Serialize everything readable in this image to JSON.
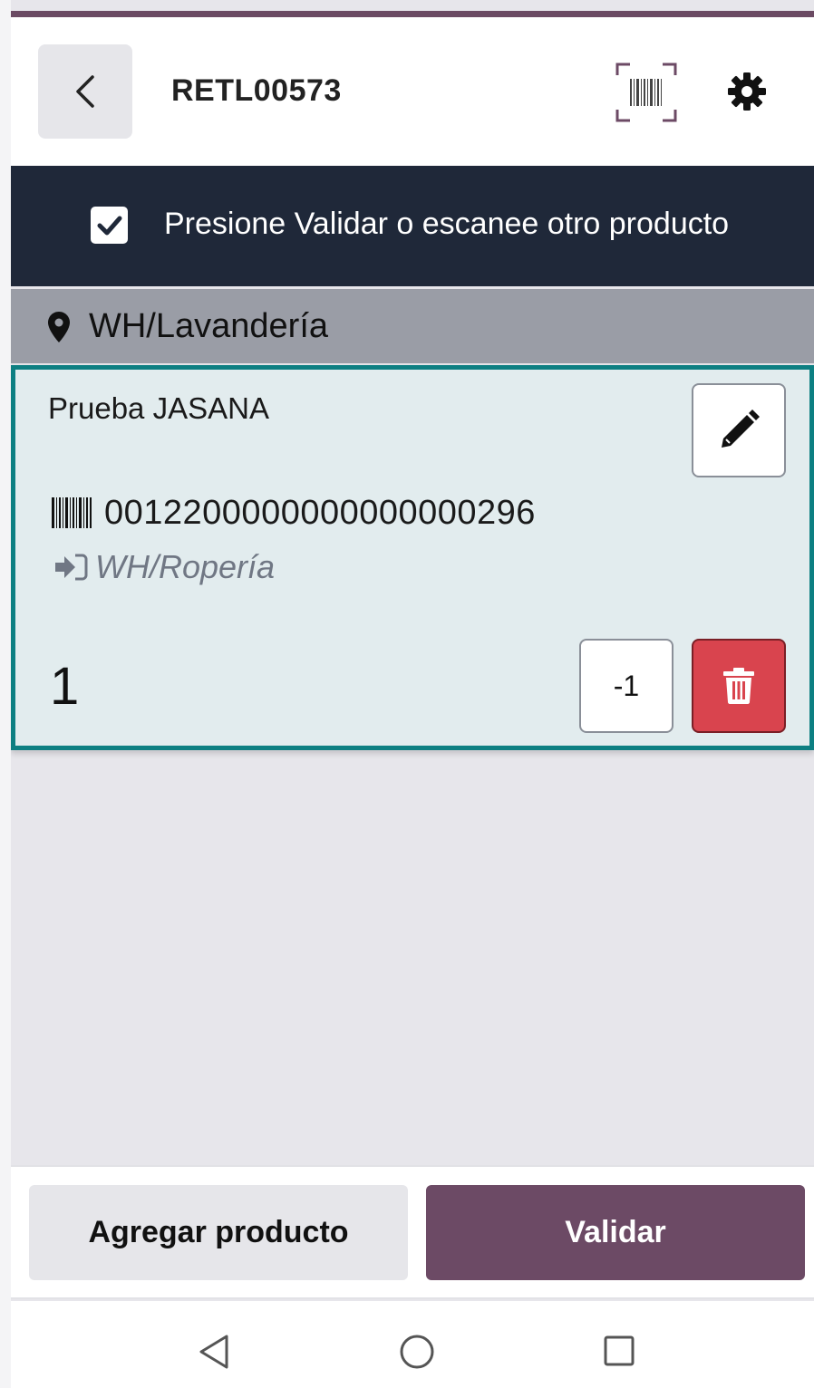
{
  "header": {
    "title": "RETL00573",
    "back_icon": "chevron-left-icon",
    "scan_icon": "barcode-scan-icon",
    "settings_icon": "gear-icon"
  },
  "banner": {
    "message": "Presione Validar o escanee otro producto",
    "icon": "checkbox-checked-icon"
  },
  "location": {
    "name": "WH/Lavandería",
    "icon": "map-pin-icon"
  },
  "line": {
    "product_name": "Prueba JASANA",
    "barcode": "0012200000000000000296",
    "destination": "WH/Ropería",
    "quantity": "1",
    "decrement_label": "-1",
    "edit_icon": "pencil-icon",
    "delete_icon": "trash-icon"
  },
  "footer": {
    "add_product_label": "Agregar producto",
    "validate_label": "Validar"
  },
  "colors": {
    "accent": "#6c4a65",
    "banner_bg": "#1f2839",
    "card_border": "#0d7f82",
    "danger": "#d9444e"
  }
}
